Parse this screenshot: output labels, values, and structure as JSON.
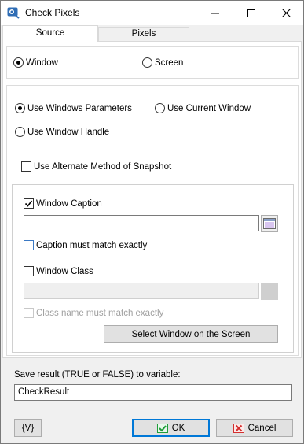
{
  "window": {
    "title": "Check Pixels"
  },
  "tabs": [
    {
      "label": "Source",
      "active": true
    },
    {
      "label": "Pixels",
      "active": false
    }
  ],
  "source": {
    "window_label": "Window",
    "screen_label": "Screen",
    "selected": "Window"
  },
  "params": {
    "use_windows_parameters": "Use Windows Parameters",
    "use_current_window": "Use Current Window",
    "use_window_handle": "Use Window Handle",
    "selected": "Use Windows Parameters",
    "alternate_snapshot": "Use Alternate Method of Snapshot",
    "alternate_snapshot_checked": false
  },
  "criteria": {
    "window_caption_label": "Window Caption",
    "window_caption_checked": true,
    "window_caption_value": "",
    "caption_exact_label": "Caption must match exactly",
    "caption_exact_checked": false,
    "window_class_label": "Window Class",
    "window_class_checked": false,
    "window_class_value": "",
    "class_exact_label": "Class name must match exactly",
    "class_exact_checked": false,
    "select_window_button": "Select Window on the Screen"
  },
  "result": {
    "label": "Save result (TRUE or FALSE) to variable:",
    "variable": "CheckResult"
  },
  "footer": {
    "variables_button": "{V}",
    "ok_button": "OK",
    "cancel_button": "Cancel"
  },
  "colors": {
    "accent": "#0078d7",
    "ok_check": "#1f9d3a",
    "cancel_x": "#d32f2f"
  }
}
